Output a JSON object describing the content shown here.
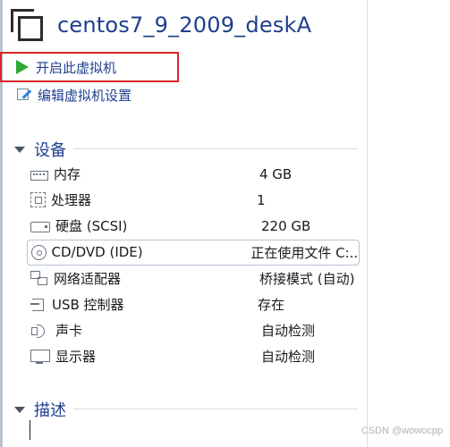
{
  "vm": {
    "title": "centos7_9_2009_deskA"
  },
  "actions": {
    "power_on_label": "开启此虚拟机",
    "edit_settings_label": "编辑虚拟机设置"
  },
  "sections": {
    "devices_label": "设备",
    "description_label": "描述"
  },
  "devices": [
    {
      "icon": "memory-icon",
      "name": "内存",
      "value": "4 GB"
    },
    {
      "icon": "processor-icon",
      "name": "处理器",
      "value": "1"
    },
    {
      "icon": "hard-disk-icon",
      "name": "硬盘 (SCSI)",
      "value": "220 GB"
    },
    {
      "icon": "cd-dvd-icon",
      "name": "CD/DVD (IDE)",
      "value": "正在使用文件 C:..."
    },
    {
      "icon": "network-adapter-icon",
      "name": "网络适配器",
      "value": "桥接模式 (自动)"
    },
    {
      "icon": "usb-controller-icon",
      "name": "USB 控制器",
      "value": "存在"
    },
    {
      "icon": "sound-card-icon",
      "name": "声卡",
      "value": "自动检测"
    },
    {
      "icon": "display-icon",
      "name": "显示器",
      "value": "自动检测"
    }
  ],
  "watermark": "CSDN @wowocpp",
  "colors": {
    "title": "#1f3f8f",
    "play": "#2fa836",
    "highlight_box": "#d8232a"
  }
}
